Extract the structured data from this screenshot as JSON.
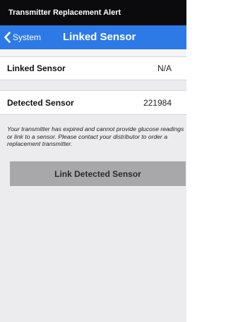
{
  "status_bar": {
    "title": "Transmitter Replacement Alert"
  },
  "nav": {
    "back_label": "System",
    "title": "Linked Sensor"
  },
  "rows": {
    "linked": {
      "label": "Linked Sensor",
      "value": "N/A"
    },
    "detected": {
      "label": "Detected Sensor",
      "value": "221984"
    }
  },
  "info": {
    "text": "Your transmitter has expired and cannot provide glucose readings or link to a sensor. Please contact your distributor to order a replacement transmitter."
  },
  "actions": {
    "link_detected_label": "Link Detected Sensor"
  },
  "icons": {
    "back": "chevron-left-icon"
  },
  "colors": {
    "nav_bar": "#2d7ae6",
    "status_bar": "#0b0b0d",
    "background": "#ececef",
    "button": "#a8a8ab"
  }
}
